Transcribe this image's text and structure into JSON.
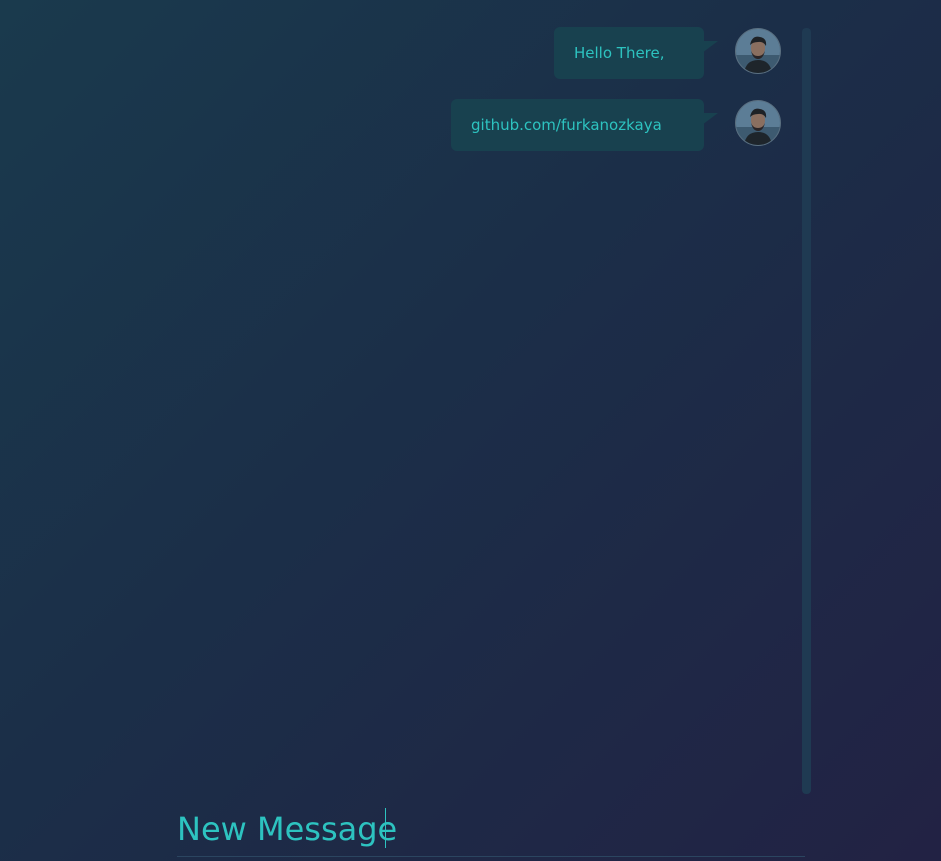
{
  "messages": [
    {
      "text": "Hello There,",
      "avatar_icon": "user-avatar-photo"
    },
    {
      "text": "github.com/furkanozkaya",
      "avatar_icon": "user-avatar-photo"
    }
  ],
  "composer": {
    "placeholder": "New Message",
    "value": ""
  },
  "colors": {
    "accent": "#2dc3c0",
    "bubble": "#18414f",
    "background_start": "#1a3a4d",
    "background_end": "#222244"
  }
}
